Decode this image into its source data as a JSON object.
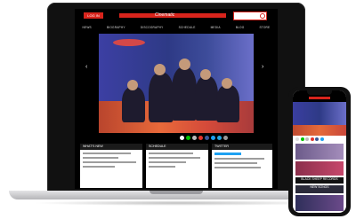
{
  "site": {
    "login_label": "LOG IN",
    "logo_text": "Cinematic",
    "search_placeholder": ""
  },
  "nav": [
    "NEWS",
    "BIOGRAPHY",
    "DISCOGRAPHY",
    "SCHEDULE",
    "MEDIA",
    "BLOG",
    "STORE"
  ],
  "panels": [
    {
      "title": "WHAT'S NEW",
      "lines": 4
    },
    {
      "title": "SCHEDULE",
      "lines": 4
    },
    {
      "title": "TWITTER",
      "lines": 4
    }
  ],
  "share_colors": [
    "#ffffff",
    "#00c300",
    "#bbbbbb",
    "#e2342c",
    "#3b5998",
    "#1da1f2",
    "#25a6e0",
    "#999999"
  ],
  "phone": {
    "banner_1": "",
    "banner_2": "BLACK SHEEP RECORDS",
    "banner_3": "NEW SONGS"
  }
}
